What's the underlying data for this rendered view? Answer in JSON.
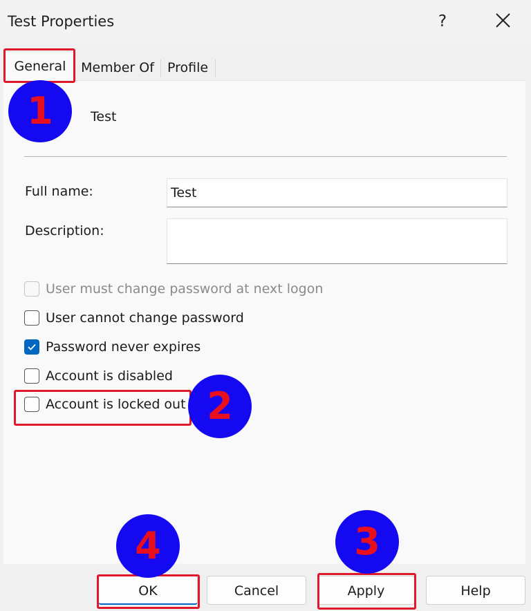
{
  "window": {
    "title": "Test Properties",
    "help_glyph": "?"
  },
  "tabs": [
    {
      "label": "General",
      "active": true
    },
    {
      "label": "Member Of",
      "active": false
    },
    {
      "label": "Profile",
      "active": false
    }
  ],
  "user": {
    "name": "Test"
  },
  "fields": {
    "full_name": {
      "label": "Full name:",
      "value": "Test"
    },
    "description": {
      "label": "Description:",
      "value": ""
    }
  },
  "checkboxes": [
    {
      "label": "User must change password at next logon",
      "checked": false,
      "disabled": true
    },
    {
      "label": "User cannot change password",
      "checked": false,
      "disabled": false
    },
    {
      "label": "Password never expires",
      "checked": true,
      "disabled": false
    },
    {
      "label": "Account is disabled",
      "checked": false,
      "disabled": false
    },
    {
      "label": "Account is locked out",
      "checked": false,
      "disabled": false
    }
  ],
  "buttons": {
    "ok": "OK",
    "cancel": "Cancel",
    "apply": "Apply",
    "help": "Help"
  },
  "markers": [
    "1",
    "2",
    "3",
    "4"
  ],
  "colors": {
    "accent": "#0067c0",
    "highlight": "#e0182c",
    "marker_fill": "#1409f0",
    "marker_text": "#e8101e"
  }
}
